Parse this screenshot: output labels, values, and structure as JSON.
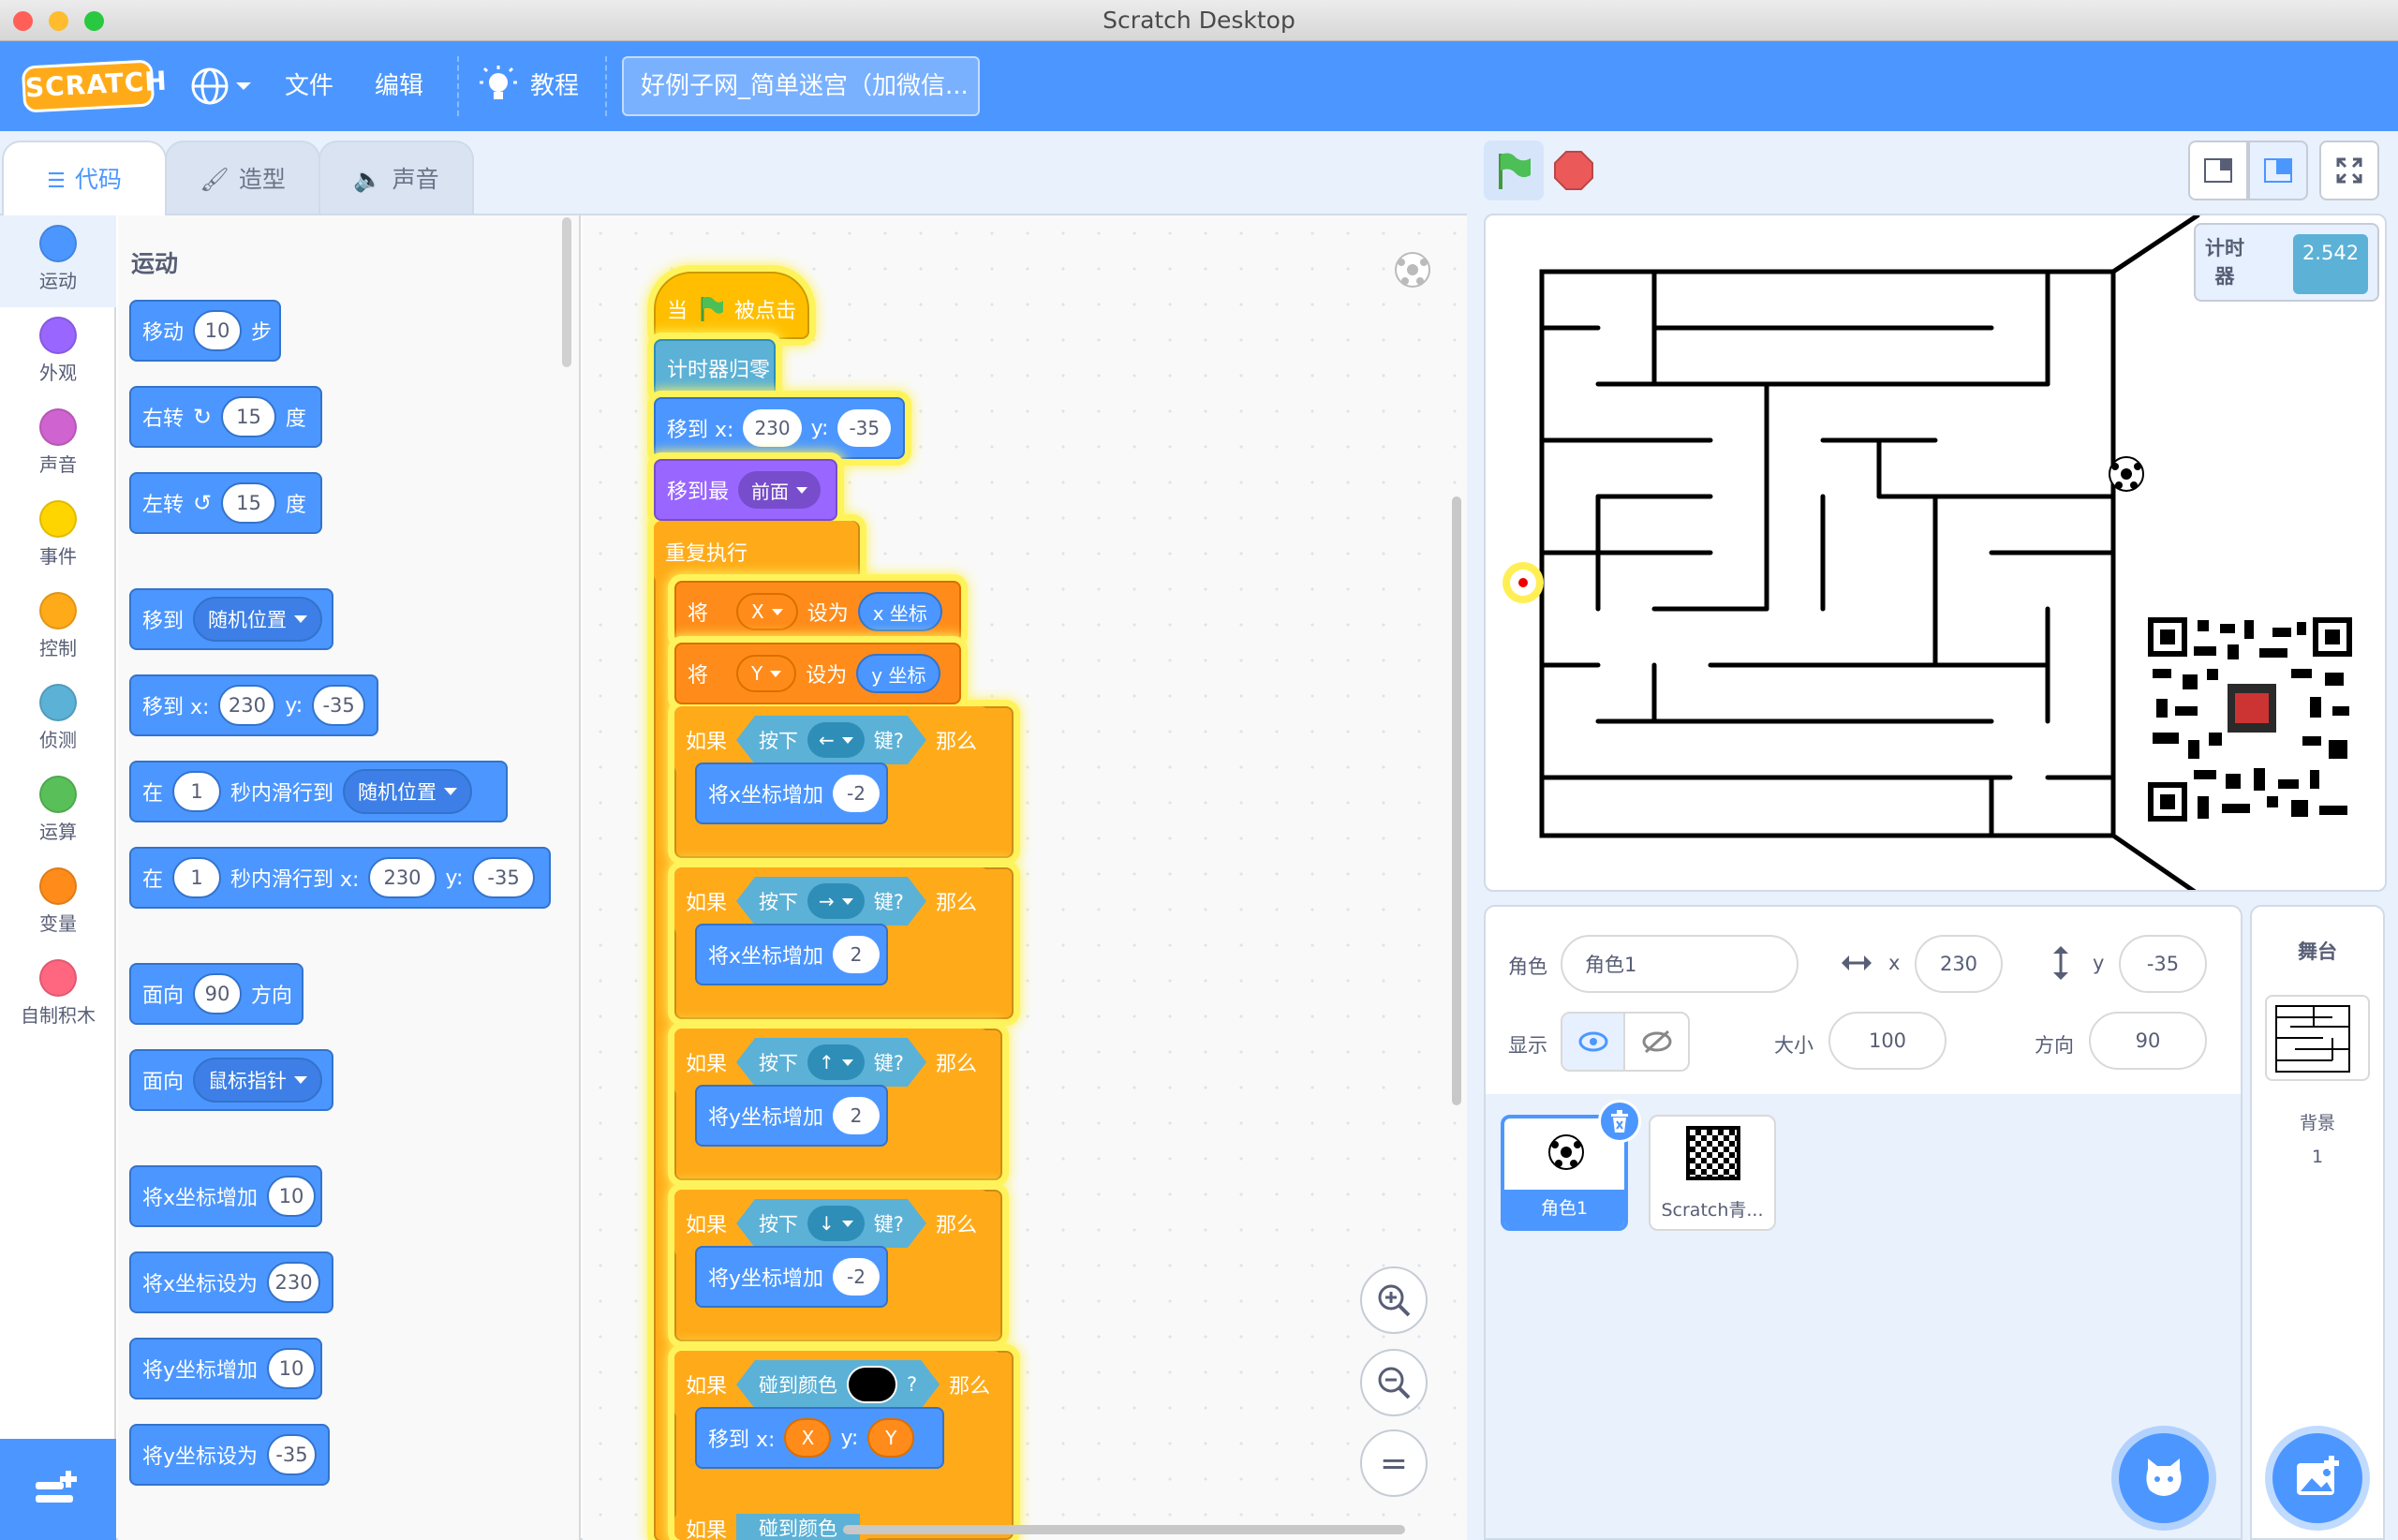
{
  "window": {
    "title": "Scratch Desktop"
  },
  "menu": {
    "file": "文件",
    "edit": "编辑",
    "tutorials": "教程",
    "project_title": "好例子网_简单迷宫（加微信...",
    "logo": "SCRATCH"
  },
  "tabs": {
    "code": "代码",
    "costumes": "造型",
    "sounds": "声音"
  },
  "categories": [
    {
      "label": "运动",
      "color": "#4c97ff"
    },
    {
      "label": "外观",
      "color": "#9966ff"
    },
    {
      "label": "声音",
      "color": "#cf63cf"
    },
    {
      "label": "事件",
      "color": "#ffd500"
    },
    {
      "label": "控制",
      "color": "#ffab19"
    },
    {
      "label": "侦测",
      "color": "#5cb1d6"
    },
    {
      "label": "运算",
      "color": "#59c059"
    },
    {
      "label": "变量",
      "color": "#ff8c1a"
    },
    {
      "label": "自制积木",
      "color": "#ff6680"
    }
  ],
  "palette": {
    "title": "运动",
    "move": {
      "a": "移动",
      "v": "10",
      "b": "步"
    },
    "turn_right": {
      "a": "右转",
      "v": "15",
      "b": "度"
    },
    "turn_left": {
      "a": "左转",
      "v": "15",
      "b": "度"
    },
    "goto": {
      "a": "移到",
      "dd": "随机位置"
    },
    "goto_xy": {
      "a": "移到 x:",
      "x": "230",
      "yl": "y:",
      "y": "-35"
    },
    "glide": {
      "a": "在",
      "v": "1",
      "b": "秒内滑行到",
      "dd": "随机位置"
    },
    "glide_xy": {
      "a": "在",
      "v": "1",
      "b": "秒内滑行到 x:",
      "x": "230",
      "yl": "y:",
      "y": "-35"
    },
    "point_dir": {
      "a": "面向",
      "v": "90",
      "b": "方向"
    },
    "point_to": {
      "a": "面向",
      "dd": "鼠标指针"
    },
    "change_x": {
      "a": "将x坐标增加",
      "v": "10"
    },
    "set_x": {
      "a": "将x坐标设为",
      "v": "230"
    },
    "change_y": {
      "a": "将y坐标增加",
      "v": "10"
    },
    "set_y": {
      "a": "将y坐标设为",
      "v": "-35"
    }
  },
  "script": {
    "hat": {
      "a": "当",
      "b": "被点击"
    },
    "reset_timer": "计时器归零",
    "goto": {
      "a": "移到 x:",
      "x": "230",
      "yl": "y:",
      "y": "-35"
    },
    "go_front": {
      "a": "移到最",
      "dd": "前面"
    },
    "forever": "重复执行",
    "setX": {
      "a": "将",
      "var": "X",
      "b": "设为",
      "rep": "x 坐标"
    },
    "setY": {
      "a": "将",
      "var": "Y",
      "b": "设为",
      "rep": "y 坐标"
    },
    "if_left": {
      "a": "如果",
      "k1": "按下",
      "key": "←",
      "k2": "键?",
      "b": "那么",
      "body": "将x坐标增加",
      "v": "-2"
    },
    "if_right": {
      "a": "如果",
      "k1": "按下",
      "key": "→",
      "k2": "键?",
      "b": "那么",
      "body": "将x坐标增加",
      "v": "2"
    },
    "if_up": {
      "a": "如果",
      "k1": "按下",
      "key": "↑",
      "k2": "键?",
      "b": "那么",
      "body": "将y坐标增加",
      "v": "2"
    },
    "if_down": {
      "a": "如果",
      "k1": "按下",
      "key": "↓",
      "k2": "键?",
      "b": "那么",
      "body": "将y坐标增加",
      "v": "-2"
    },
    "if_color": {
      "a": "如果",
      "k1": "碰到颜色",
      "q": "?",
      "b": "那么",
      "body": "移到 x:",
      "x": "X",
      "yl": "y:",
      "y": "Y"
    },
    "last": {
      "a": "如果",
      "k1": "碰到颜色"
    }
  },
  "zoom": {
    "reset": "="
  },
  "stage": {
    "timer_label": "计时器",
    "timer_value": "2.542"
  },
  "sprite_info": {
    "sprite_label": "角色",
    "sprite_name": "角色1",
    "x_label": "x",
    "x": "230",
    "y_label": "y",
    "y": "-35",
    "show_label": "显示",
    "size_label": "大小",
    "size": "100",
    "dir_label": "方向",
    "dir": "90"
  },
  "sprites": [
    {
      "name": "角色1",
      "selected": true
    },
    {
      "name": "Scratch青..."
    }
  ],
  "stage_panel": {
    "title": "舞台",
    "backdrop_label": "背景",
    "backdrop_count": "1"
  }
}
